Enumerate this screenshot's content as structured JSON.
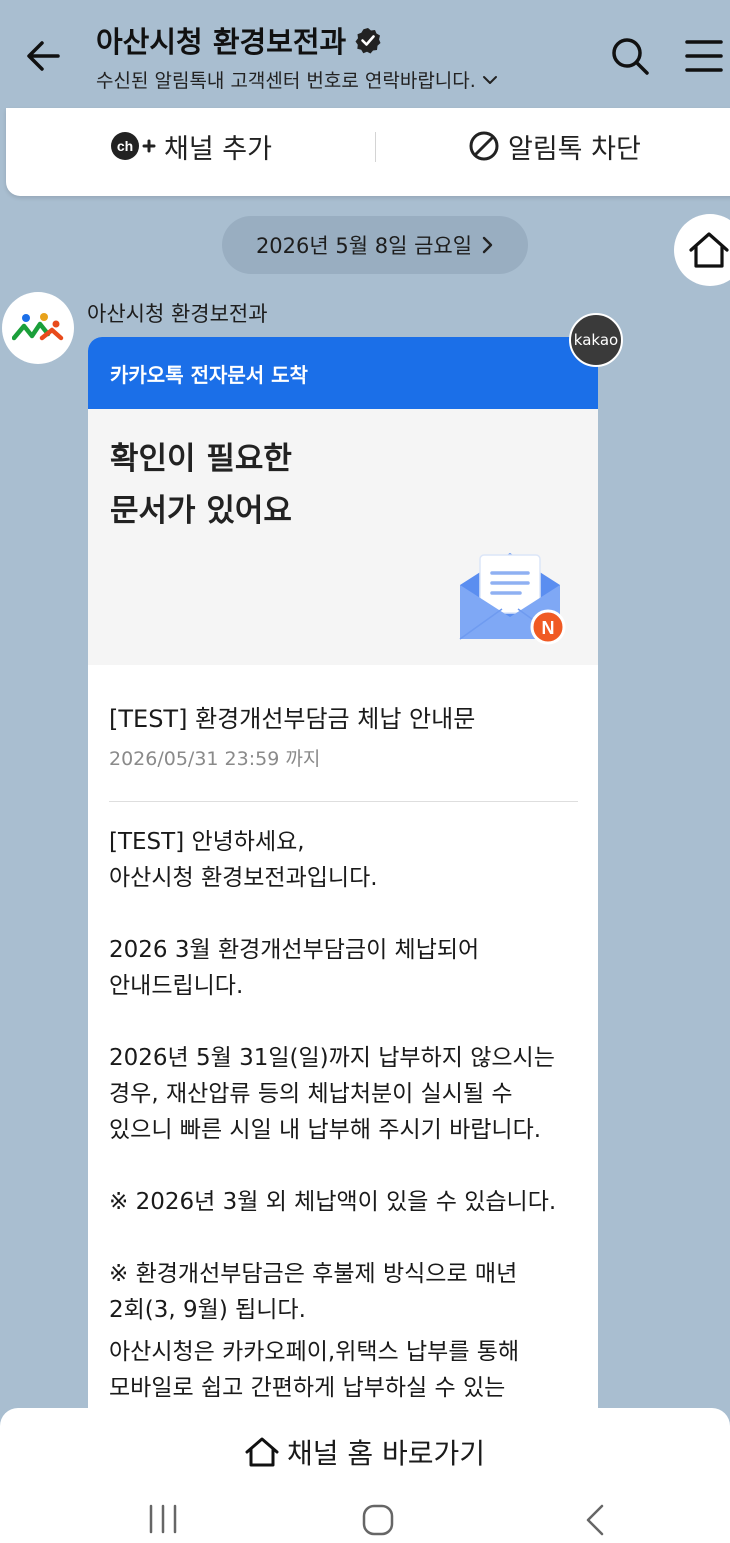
{
  "header": {
    "title": "아산시청 환경보전과",
    "subtitle": "수신된 알림톡내 고객센터 번호로 연락바랍니다."
  },
  "actions": {
    "add_channel": "채널 추가",
    "block": "알림톡 차단"
  },
  "date_label": "2026년 5월 8일 금요일",
  "sender": {
    "name": "아산시청 환경보전과"
  },
  "message": {
    "badge": "kakao",
    "header": "카카오톡 전자문서 도착",
    "hero_line1": "확인이 필요한",
    "hero_line2": "문서가 있어요",
    "envelope_badge": "N",
    "doc_title": "[TEST] 환경개선부담금 체납 안내문",
    "doc_deadline": "2026/05/31 23:59 까지",
    "para1": "[TEST] 안녕하세요,\n아산시청 환경보전과입니다.",
    "para2": "2026 3월 환경개선부담금이 체납되어\n안내드립니다.",
    "para3": "2026년 5월 31일(일)까지 납부하지 않으시는\n경우, 재산압류 등의 체납처분이 실시될 수\n있으니 빠른 시일 내 납부해 주시기 바랍니다.",
    "para4": "※ 2026년 3월 외 체납액이 있을 수 있습니다.",
    "para5": "※ 환경개선부담금은 후불제 방식으로 매년\n2회(3, 9월) 됩니다.",
    "para6": "아산시청은 카카오페이,위택스 납부를 통해\n모바일로 쉽고 간편하게 납부하실 수 있는"
  },
  "bottom": {
    "channel_home": "채널 홈 바로가기"
  },
  "colors": {
    "background": "#a9bed0",
    "card_header": "#1b6fe8",
    "badge_orange": "#f05a24"
  },
  "icons": [
    "back-arrow-icon",
    "verified-icon",
    "chevron-down-icon",
    "search-icon",
    "menu-icon",
    "channel-add-icon",
    "block-icon",
    "chevron-right-icon",
    "home-icon",
    "envelope-icon"
  ]
}
